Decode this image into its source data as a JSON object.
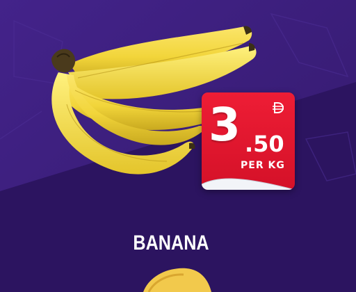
{
  "product": {
    "name": "BANANA",
    "image": "banana-bunch"
  },
  "price": {
    "currency_icon": "dirham-symbol-icon",
    "integer": "3",
    "decimal": ".50",
    "unit": "PER KG"
  },
  "colors": {
    "background": "#3b1d78",
    "background_accent": "#2a1257",
    "tag_red": "#e3192f",
    "text": "#ffffff"
  }
}
